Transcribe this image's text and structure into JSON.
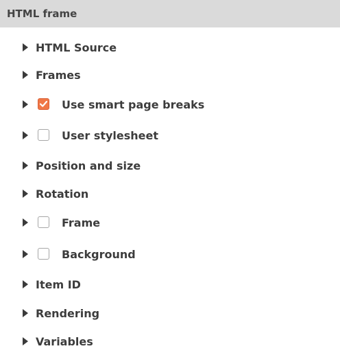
{
  "header": {
    "title": "HTML frame"
  },
  "groups": [
    {
      "label": "HTML Source",
      "has_checkbox": false
    },
    {
      "label": "Frames",
      "has_checkbox": false
    },
    {
      "label": "Use smart page breaks",
      "has_checkbox": true,
      "checked": true
    },
    {
      "label": "User stylesheet",
      "has_checkbox": true,
      "checked": false
    },
    {
      "label": "Position and size",
      "has_checkbox": false
    },
    {
      "label": "Rotation",
      "has_checkbox": false
    },
    {
      "label": "Frame",
      "has_checkbox": true,
      "checked": false
    },
    {
      "label": "Background",
      "has_checkbox": true,
      "checked": false
    },
    {
      "label": "Item ID",
      "has_checkbox": false
    },
    {
      "label": "Rendering",
      "has_checkbox": false
    },
    {
      "label": "Variables",
      "has_checkbox": false
    }
  ],
  "colors": {
    "header_bg": "#dadada",
    "checkbox_checked": "#f07746",
    "text": "#3c3c3c"
  },
  "icons": {
    "expand": "triangle-right-icon",
    "check": "checkmark-icon"
  }
}
